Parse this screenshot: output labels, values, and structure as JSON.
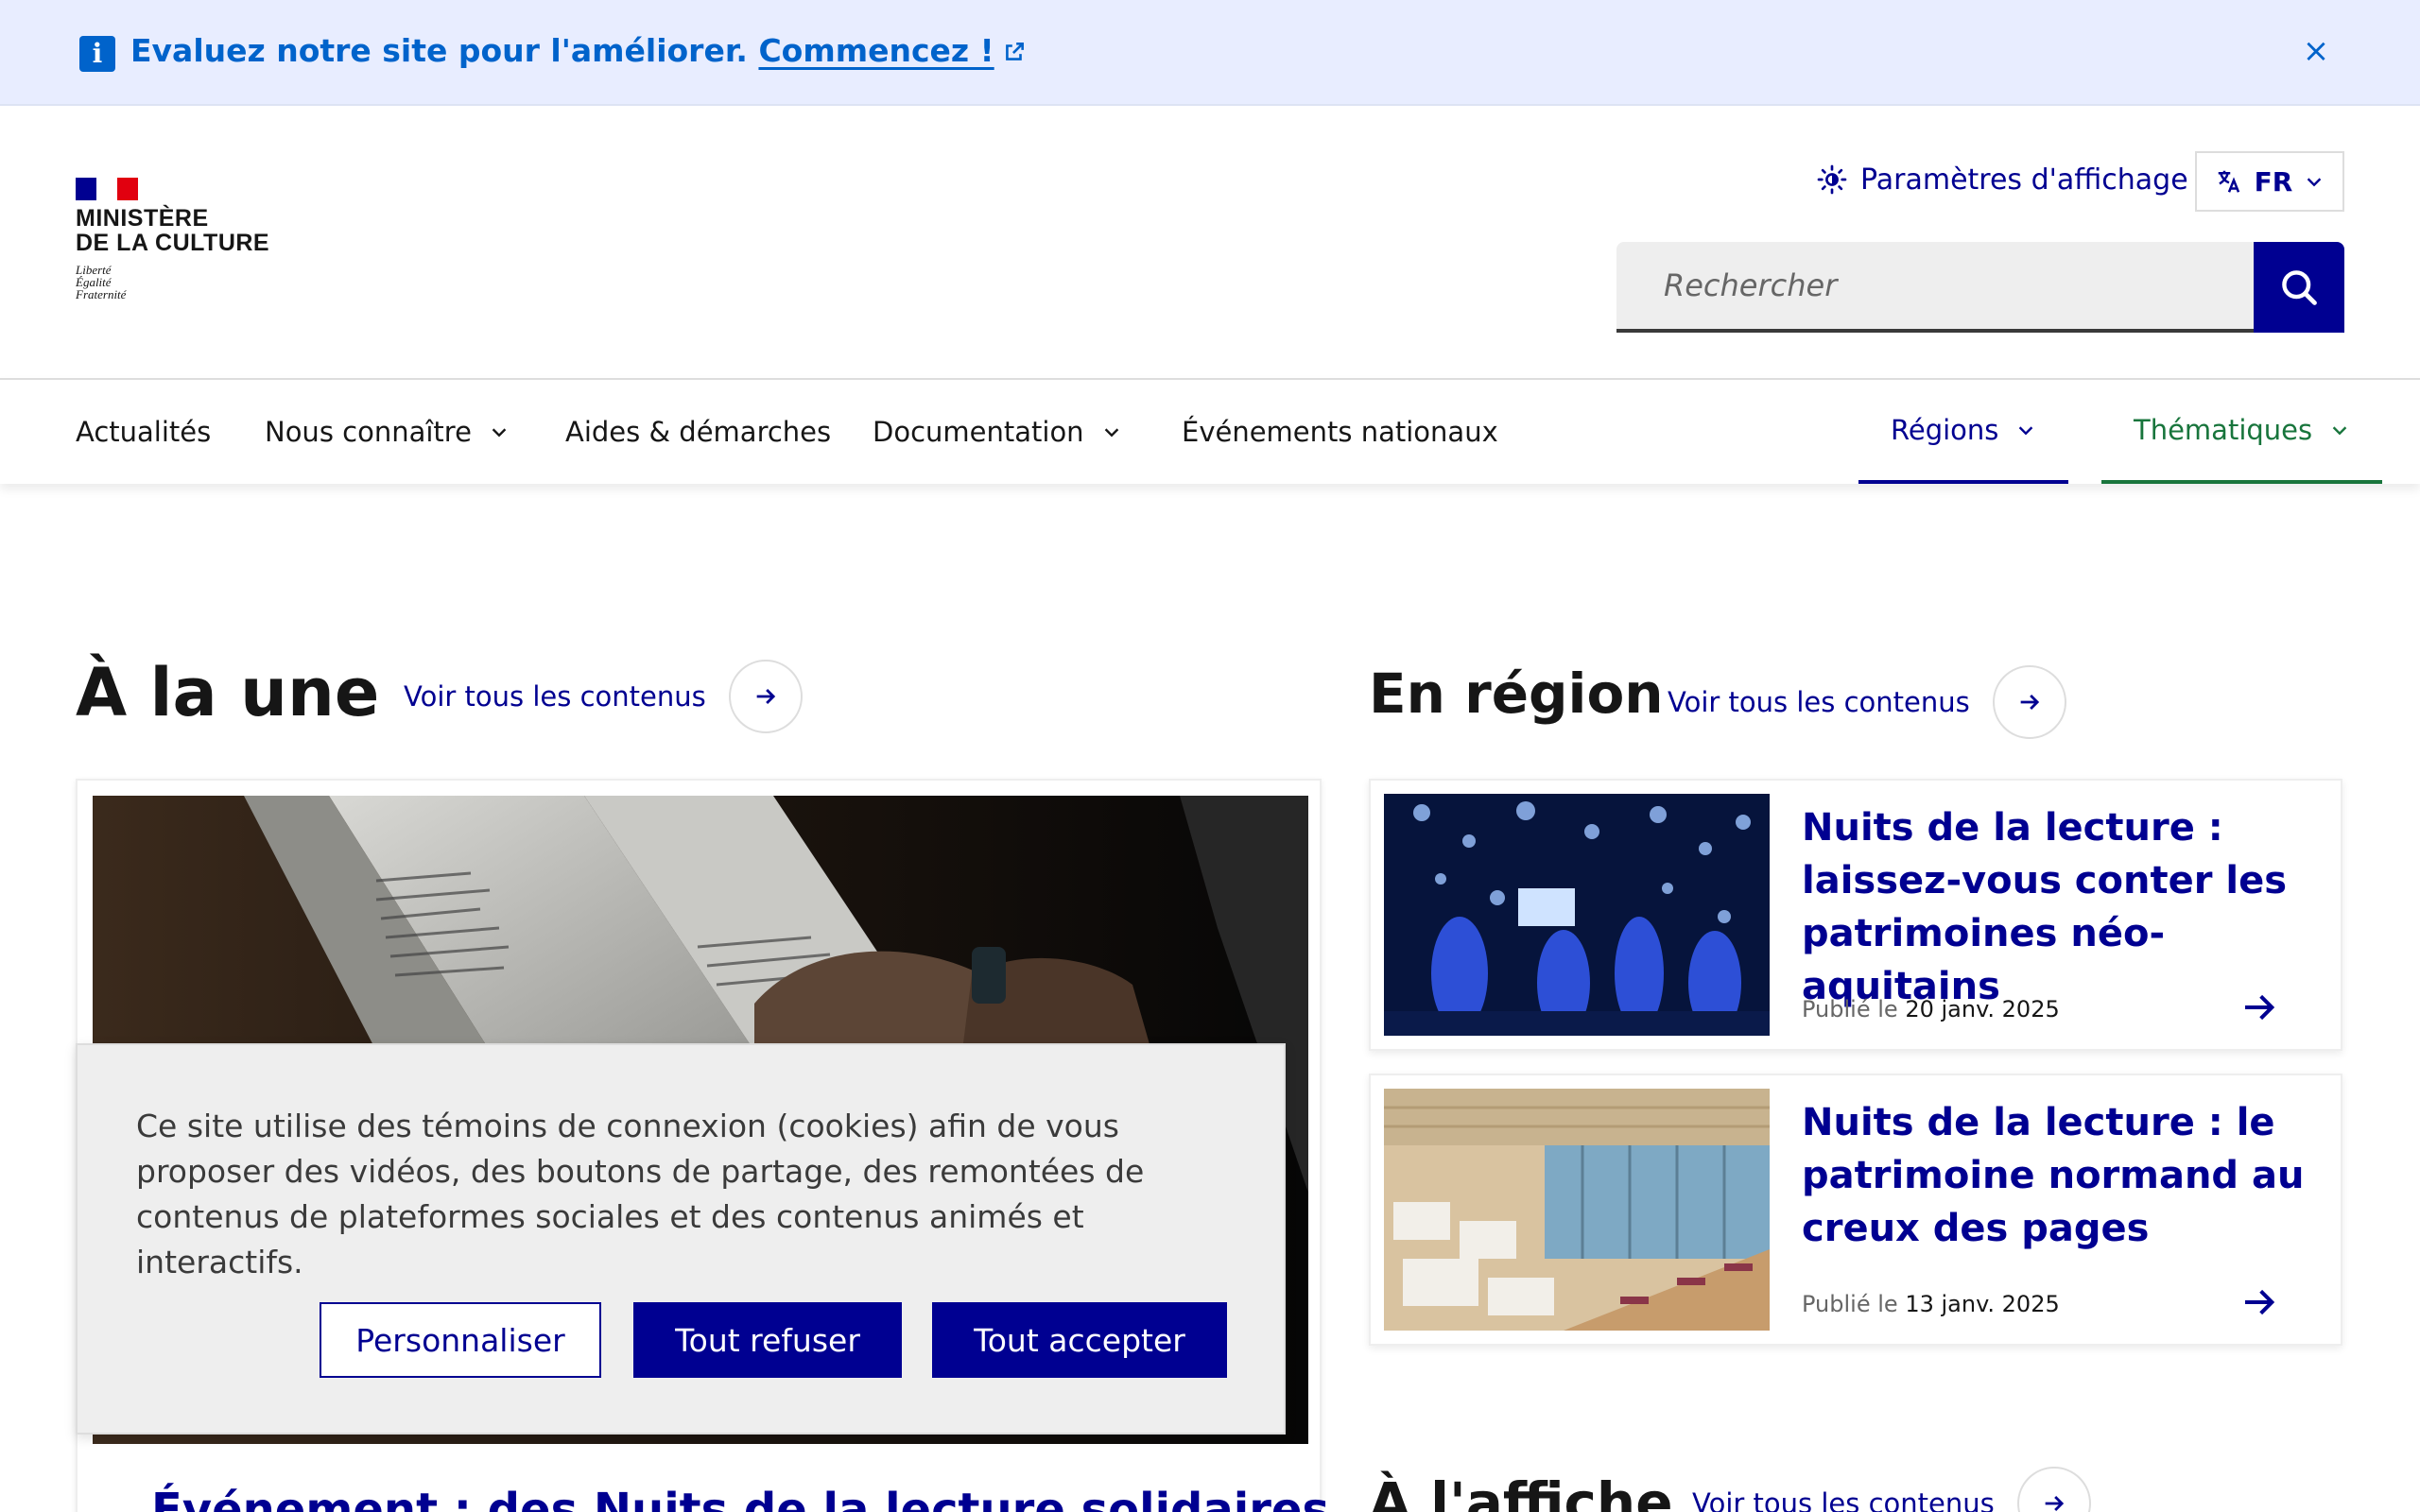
{
  "notice": {
    "text": "Evaluez notre site pour l'améliorer.",
    "link": "Commencez !",
    "close_label": "×"
  },
  "header": {
    "org_line1": "MINISTÈRE",
    "org_line2": "DE LA CULTURE",
    "motto_1": "Liberté",
    "motto_2": "Égalité",
    "motto_3": "Fraternité",
    "display_settings": "Paramètres d'affichage",
    "language": "FR",
    "search_placeholder": "Rechercher"
  },
  "nav": {
    "items": [
      {
        "label": "Actualités"
      },
      {
        "label": "Nous connaître"
      },
      {
        "label": "Aides & démarches"
      },
      {
        "label": "Documentation"
      },
      {
        "label": "Événements nationaux"
      },
      {
        "label": "Régions"
      },
      {
        "label": "Thématiques"
      }
    ]
  },
  "main": {
    "une_title": "À la une",
    "see_all": "Voir tous les contenus",
    "featured_title": "Événement : des Nuits de la lecture solidaires",
    "region_title": "En région",
    "affiche_title": "À l'affiche",
    "region_cards": [
      {
        "title": "Nuits de la lecture : laissez-vous conter les patrimoines néo-aquitains",
        "date_label": "Publié le",
        "date": "20 janv. 2025"
      },
      {
        "title": "Nuits de la lecture : le patrimoine normand au creux des pages",
        "date_label": "Publié le",
        "date": "13 janv. 2025"
      }
    ]
  },
  "cookie": {
    "text": "Ce site utilise des témoins de connexion (cookies) afin de vous proposer des vidéos, des boutons de partage, des remontées de contenus de plateformes sociales et des contenus animés et interactifs.",
    "customize": "Personnaliser",
    "refuse": "Tout refuser",
    "accept": "Tout accepter"
  },
  "colors": {
    "primary": "#000091",
    "notice_bg": "#e8edff",
    "notice_text": "#0063cb",
    "themes_accent": "#18753c"
  }
}
